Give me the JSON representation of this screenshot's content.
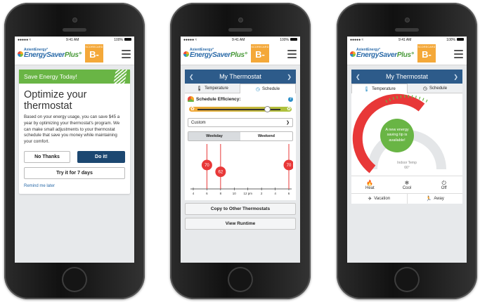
{
  "status": {
    "time": "9:41 AM",
    "battery": "100%",
    "carrier": "●●●●● ≈"
  },
  "brand": {
    "line1": "AxientEnergy°",
    "line2_main": "EnergySaver",
    "line2_plus": "Plus°"
  },
  "scorecard": {
    "label": "SCORECARD",
    "grade": "B-"
  },
  "screen1": {
    "banner": "Save Energy Today!",
    "heading": "Optimize your thermostat",
    "body": "Based on your energy usage, you can save $45 a year by optimizing your thermostat's program. We can make small adjustments to your thermostat schedule that save you money while maintaining your comfort.",
    "no_thanks": "No Thanks",
    "do_it": "Do it!",
    "try_it": "Try it for 7 days",
    "remind": "Remind me later"
  },
  "screen2": {
    "title": "My Thermostat",
    "tab_temperature": "Temperature",
    "tab_schedule": "Schedule",
    "efficiency_label": "Schedule Efficiency:",
    "efficiency_level": 0.78,
    "select_value": "Custom",
    "seg_weekday": "Weekday",
    "seg_weekend": "Weekend",
    "copy_button": "Copy to Other Thermostats",
    "runtime_button": "View Runtime"
  },
  "chart_data": {
    "type": "scatter",
    "x_ticks": [
      "4",
      "6",
      "8",
      "10",
      "12 pm",
      "2",
      "4",
      "6"
    ],
    "points": [
      {
        "x": "6",
        "y": 70,
        "label": "70"
      },
      {
        "x": "8",
        "y": 62,
        "label": "62"
      },
      {
        "x": "6 pm",
        "y": 70,
        "label": "70"
      }
    ],
    "title": "",
    "xlabel": "",
    "ylabel": ""
  },
  "screen3": {
    "title": "My Thermostat",
    "tab_temperature": "Temperature",
    "tab_schedule": "Schedule",
    "bubble": "A new energy saving tip is available!",
    "indoor_label": "Indoor Temp",
    "indoor_value": "66°",
    "heat": "Heat",
    "cool": "Cool",
    "off": "Off",
    "vacation": "Vacation",
    "away": "Away"
  },
  "colors": {
    "green": "#69b545",
    "navy": "#1c4771",
    "header_blue": "#2d5b8a",
    "orange": "#f4a839",
    "red": "#e83838"
  }
}
